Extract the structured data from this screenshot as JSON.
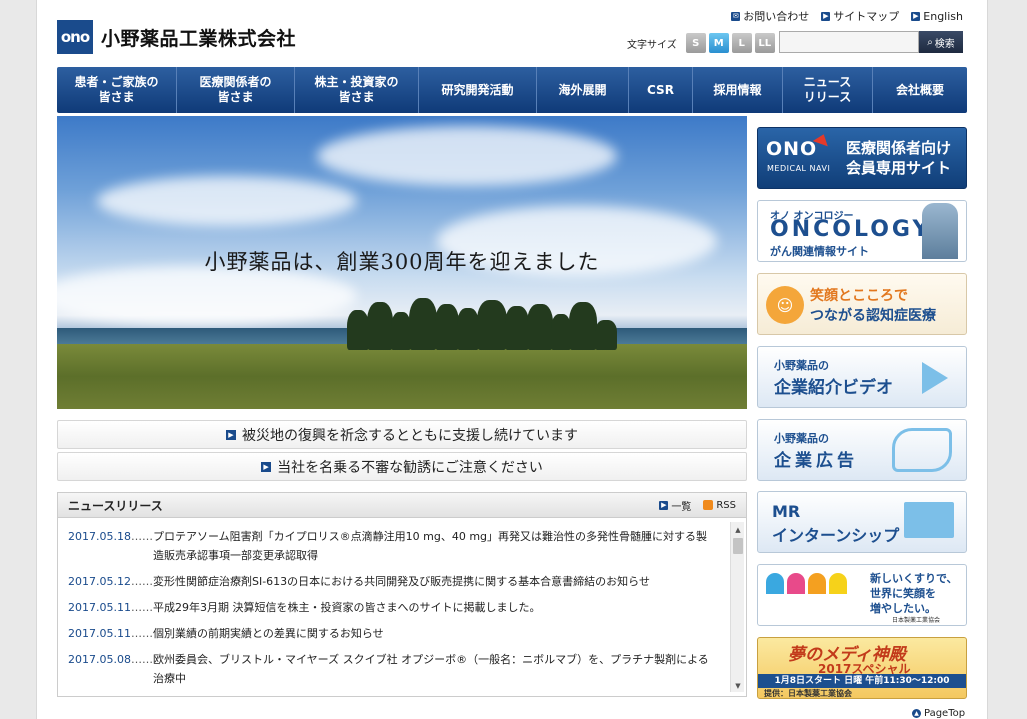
{
  "header": {
    "logo_mark": "ono",
    "logo_text": "小野薬品工業株式会社",
    "util_links": [
      "お問い合わせ",
      "サイトマップ",
      "English"
    ],
    "font_size_label": "文字サイズ",
    "font_sizes": [
      "S",
      "M",
      "L",
      "LL"
    ],
    "active_font_size": "M",
    "search_placeholder": "",
    "search_button": "検索"
  },
  "nav": {
    "items": [
      {
        "label": "患者・ご家族の\n皆さま"
      },
      {
        "label": "医療関係者の\n皆さま"
      },
      {
        "label": "株主・投資家の\n皆さま"
      },
      {
        "label": "研究開発活動"
      },
      {
        "label": "海外展開"
      },
      {
        "label": "CSR"
      },
      {
        "label": "採用情報"
      },
      {
        "label": "ニュース\nリリース"
      },
      {
        "label": "会社概要"
      }
    ]
  },
  "hero": {
    "caption": "小野薬品は、創業300周年を迎えました"
  },
  "notices": [
    {
      "label": "被災地の復興を祈念するとともに支援し続けています"
    },
    {
      "label": "当社を名乗る不審な勧誘にご注意ください"
    }
  ],
  "news": {
    "title": "ニュースリリース",
    "list_link": "一覧",
    "rss_link": "RSS",
    "separator": "……",
    "items": [
      {
        "date": "2017.05.18",
        "text": "プロテアソーム阻害剤「カイプロリス®点滴静注用10 mg、40 mg」再発又は難治性の多発性骨髄腫に対する製造販売承認事項一部変更承認取得"
      },
      {
        "date": "2017.05.12",
        "text": "変形性関節症治療剤SI-613の日本における共同開発及び販売提携に関する基本合意書締結のお知らせ"
      },
      {
        "date": "2017.05.11",
        "text": "平成29年3月期 決算短信を株主・投資家の皆さまへのサイトに掲載しました。"
      },
      {
        "date": "2017.05.11",
        "text": "個別業績の前期実績との差異に関するお知らせ"
      },
      {
        "date": "2017.05.08",
        "text": "欧州委員会、ブリストル・マイヤーズ スクイブ社 オプジーボ®（一般名：ニボルマブ）を、プラチナ製剤による治療中"
      }
    ]
  },
  "banners": {
    "medical_navi": {
      "brand": "ONO",
      "sub": "MEDICAL NAVI",
      "line1": "医療関係者向け",
      "line2": "会員専用サイト"
    },
    "oncology": {
      "small": "オノ オンコロジー",
      "big": "ONCOLOGY",
      "sub": "がん関連情報サイト"
    },
    "dementia": {
      "line1": "笑顔とこころで",
      "line2": "つながる認知症医療"
    },
    "video": {
      "line1": "小野薬品の",
      "line2": "企業紹介ビデオ"
    },
    "ad": {
      "line1": "小野薬品の",
      "line2": "企業広告"
    },
    "mr": {
      "line1": "MR",
      "line2": "インターンシップ"
    },
    "jpma": {
      "line1": "新しいくすりで、",
      "line2": "世界に笑顔を",
      "line3": "増やしたい。",
      "org": "日本製薬工業協会"
    },
    "medi": {
      "title": "夢のメディ神殿",
      "sub": "2017スペシャル",
      "schedule": "1月8日スタート 日曜 午前11:30～12:00",
      "credit": "提供：日本製薬工業協会"
    }
  },
  "footer": {
    "pagetop": "PageTop"
  },
  "colors": {
    "brand": "#1a4b8c",
    "nav_top": "#2d5fa0",
    "nav_bottom": "#0f3a78"
  }
}
